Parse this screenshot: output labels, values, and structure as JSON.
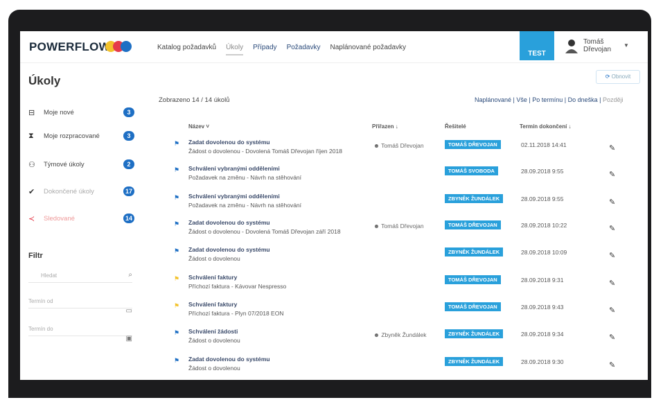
{
  "nav": {
    "logo": "POWERFLOW",
    "links": [
      "Katalog požadavků",
      "Úkoly",
      "Případy",
      "Požadavky",
      "Naplánované požadavky"
    ],
    "env_badge": "TEST",
    "user_name": "Tomáš Dřevojan"
  },
  "page_title": "Úkoly",
  "sidebar": {
    "items": [
      {
        "icon": "inbox-icon",
        "label": "Moje nové",
        "count": "3"
      },
      {
        "icon": "hourglass-icon",
        "label": "Moje rozpracované",
        "count": "3"
      },
      {
        "icon": "team-icon",
        "label": "Týmové úkoly",
        "count": "2"
      },
      {
        "icon": "check-icon",
        "label": "Dokončené úkoly",
        "count": "17"
      },
      {
        "icon": "share-icon",
        "label": "Sledované",
        "count": "14"
      }
    ],
    "filter_title": "Filtr",
    "filter_fields": [
      "Hledat",
      "Termín od",
      "Termín do"
    ]
  },
  "main": {
    "refresh_label": "Obnovit",
    "shown_text": "Zobrazeno 14 / 14 úkolů",
    "sort_options": [
      "Naplánované",
      "Vše",
      "Po termínu",
      "Do dneška",
      "Později"
    ],
    "columns": [
      "Název ˅",
      "Přiřazen ↓",
      "Řešitelé",
      "Termín dokončení ↓"
    ],
    "rows": [
      {
        "name": "Zadat dovolenou do systému",
        "desc": "Žádost o dovolenou - Dovolená Tomáš Dřevojan říjen 2018",
        "assignee": "Tomáš Dřevojan",
        "resolver": "TOMÁŠ DŘEVOJAN",
        "deadline": "02.11.2018 14:41",
        "flag_color": "#1e6fc4"
      },
      {
        "name": "Schválení vybranými odděleními",
        "desc": "Požadavek na změnu - Návrh na stěhování",
        "assignee": "",
        "resolver": "TOMÁŠ SVOBODA",
        "deadline": "28.09.2018 9:55",
        "flag_color": "#1e6fc4"
      },
      {
        "name": "Schválení vybranými odděleními",
        "desc": "Požadavek na změnu - Návrh na stěhování",
        "assignee": "",
        "resolver": "ZBYNĚK ŽUNDÁLEK",
        "deadline": "28.09.2018 9:55",
        "flag_color": "#1e6fc4"
      },
      {
        "name": "Zadat dovolenou do systému",
        "desc": "Žádost o dovolenou - Dovolená Tomáš Dřevojan září 2018",
        "assignee": "Tomáš Dřevojan",
        "resolver": "TOMÁŠ DŘEVOJAN",
        "deadline": "28.09.2018 10:22",
        "flag_color": "#1e6fc4"
      },
      {
        "name": "Zadat dovolenou do systému",
        "desc": "Žádost o dovolenou",
        "assignee": "",
        "resolver": "ZBYNĚK ŽUNDÁLEK",
        "deadline": "28.09.2018 10:09",
        "flag_color": "#1e6fc4"
      },
      {
        "name": "Schválení faktury",
        "desc": "Příchozí faktura - Kávovar Nespresso",
        "assignee": "",
        "resolver": "TOMÁŠ DŘEVOJAN",
        "deadline": "28.09.2018 9:31",
        "flag_color": "#f3c22b"
      },
      {
        "name": "Schválení faktury",
        "desc": "Příchozí faktura - Plyn 07/2018 EON",
        "assignee": "",
        "resolver": "TOMÁŠ DŘEVOJAN",
        "deadline": "28.09.2018 9:43",
        "flag_color": "#f3c22b"
      },
      {
        "name": "Schválení žádosti",
        "desc": "Žádost o dovolenou",
        "assignee": "Zbyněk Žundálek",
        "resolver": "ZBYNĚK ŽUNDÁLEK",
        "deadline": "28.09.2018 9:34",
        "flag_color": "#1e6fc4"
      },
      {
        "name": "Zadat dovolenou do systému",
        "desc": "Žádost o dovolenou",
        "assignee": "",
        "resolver": "ZBYNĚK ŽUNDÁLEK",
        "deadline": "28.09.2018 9:30",
        "flag_color": "#1e6fc4"
      }
    ]
  },
  "colors": {
    "accent": "#29a0db",
    "count_badge": "#1e6fc4",
    "logo_dots": [
      "#f3c22b",
      "#e53b4a",
      "#1e6fc4"
    ]
  }
}
